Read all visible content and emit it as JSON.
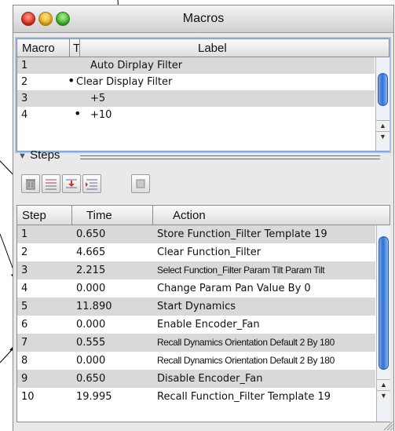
{
  "window": {
    "title": "Macros"
  },
  "macros_table": {
    "headers": {
      "macro": "Macro",
      "t": "T",
      "label": "Label"
    },
    "rows": [
      {
        "macro": "1",
        "t": "",
        "label": "Auto Dirplay Filter"
      },
      {
        "macro": "2",
        "t": "•",
        "label": "Clear Display Filter"
      },
      {
        "macro": "3",
        "t": "",
        "label": "+5"
      },
      {
        "macro": "4",
        "t": "•",
        "label": "+10"
      }
    ]
  },
  "steps_section": {
    "title": "Steps",
    "toolbar": {
      "icons": [
        "trash-icon",
        "insert-step-icon",
        "move-step-icon",
        "indent-step-icon",
        "record-stop-icon"
      ]
    }
  },
  "steps_table": {
    "headers": {
      "step": "Step",
      "time": "Time",
      "action": "Action"
    },
    "rows": [
      {
        "step": "1",
        "time": "0.650",
        "action": "Store Function_Filter Template 19"
      },
      {
        "step": "2",
        "time": "4.665",
        "action": "Clear Function_Filter"
      },
      {
        "step": "3",
        "time": "2.215",
        "action": "Select Function_Filter Param Tilt Param Tilt"
      },
      {
        "step": "4",
        "time": "0.000",
        "action": "Change Param Pan Value By 0"
      },
      {
        "step": "5",
        "time": "11.890",
        "action": "Start Dynamics"
      },
      {
        "step": "6",
        "time": "0.000",
        "action": "Enable Encoder_Fan"
      },
      {
        "step": "7",
        "time": "0.555",
        "action": "Recall Dynamics Orientation Default 2 By 180"
      },
      {
        "step": "8",
        "time": "0.000",
        "action": "Recall Dynamics Orientation Default 2 By 180"
      },
      {
        "step": "9",
        "time": "0.650",
        "action": "Disable Encoder_Fan"
      },
      {
        "step": "10",
        "time": "19.995",
        "action": "Recall Function_Filter Template 19"
      }
    ]
  }
}
